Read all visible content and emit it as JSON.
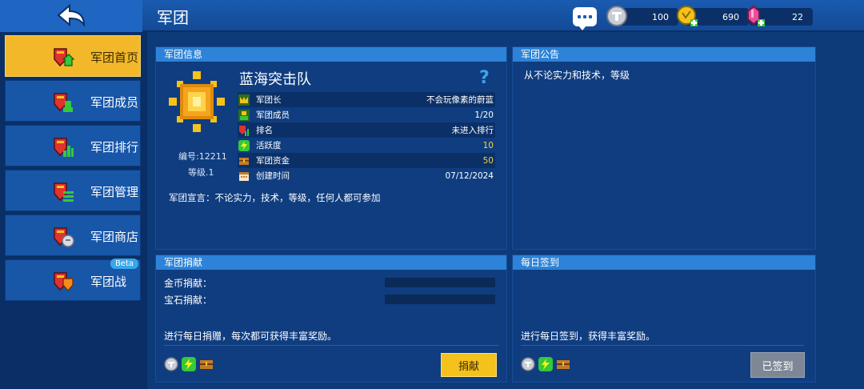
{
  "header": {
    "title": "军团",
    "currencies": [
      {
        "icon": "silver-coin-icon",
        "value": "100"
      },
      {
        "icon": "gold-coin-icon",
        "value": "690"
      },
      {
        "icon": "pink-gem-icon",
        "value": "22"
      }
    ]
  },
  "sidebar": {
    "items": [
      {
        "label": "军团首页",
        "icon": "guild-home-icon",
        "active": true
      },
      {
        "label": "军团成员",
        "icon": "guild-members-icon"
      },
      {
        "label": "军团排行",
        "icon": "guild-ranking-icon"
      },
      {
        "label": "军团管理",
        "icon": "guild-manage-icon"
      },
      {
        "label": "军团商店",
        "icon": "guild-shop-icon"
      },
      {
        "label": "军团战",
        "icon": "guild-war-icon",
        "badge": "Beta"
      }
    ]
  },
  "guild_info": {
    "heading": "军团信息",
    "name": "蓝海突击队",
    "help": "?",
    "id_text": "编号:12211",
    "level_text": "等级.1",
    "rows": [
      {
        "label": "军团长",
        "value": "不会玩像素的蔚蓝",
        "icon": "crown-icon"
      },
      {
        "label": "军团成员",
        "value": "1/20",
        "icon": "member-icon"
      },
      {
        "label": "排名",
        "value": "未进入排行",
        "icon": "rank-icon"
      },
      {
        "label": "活跃度",
        "value": "10",
        "icon": "lightning-icon",
        "highlight": true
      },
      {
        "label": "军团资金",
        "value": "50",
        "icon": "treasure-chest-icon",
        "highlight": true
      },
      {
        "label": "创建时间",
        "value": "07/12/2024",
        "icon": "calendar-icon"
      }
    ],
    "declaration": "军团宣言：不论实力，技术，等级，任何人都可参加"
  },
  "notice": {
    "heading": "军团公告",
    "text": "从不论实力和技术，等级"
  },
  "donation": {
    "heading": "军团捐献",
    "coin_label": "金币捐献：",
    "gem_label": "宝石捐献：",
    "description": "进行每日捐赠，每次都可获得丰富奖励。",
    "button": "捐献"
  },
  "checkin": {
    "heading": "每日签到",
    "description": "进行每日签到，获得丰富奖励。",
    "button": "已签到"
  },
  "colors": {
    "accent_yellow": "#f5c21d",
    "panel_header": "#2c83d8",
    "background": "#0d3a78"
  }
}
